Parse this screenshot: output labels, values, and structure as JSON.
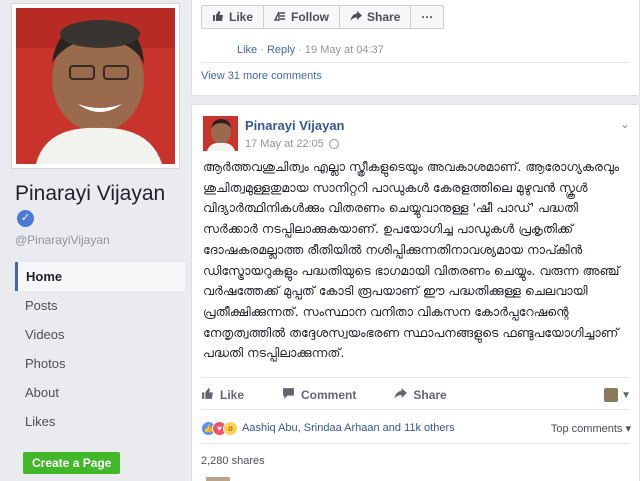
{
  "profile": {
    "name": "Pinarayi Vijayan",
    "verified_mark": "✓",
    "handle": "@PinarayiVijayan"
  },
  "nav": {
    "items": [
      "Home",
      "Posts",
      "Videos",
      "Photos",
      "About",
      "Likes"
    ],
    "active": "Home"
  },
  "create_page_label": "Create a Page",
  "previous_post": {
    "actions": {
      "like": "Like",
      "follow": "Follow",
      "share": "Share",
      "more": "···"
    },
    "comment_meta": {
      "like": "Like",
      "reply": "Reply",
      "time": "19 May at 04:37"
    },
    "view_more": "View 31 more comments"
  },
  "post": {
    "author": "Pinarayi Vijayan",
    "time": "17 May at 22:05",
    "text": "ആർത്തവശുചിത്വം എല്ലാ സ്ത്രീകളുടെയും അവകാശമാണ്. ആരോഗ്യകരവും ശുചിത്വമുള്ളതുമായ സാനിറ്ററി പാഡുകൾ കേരളത്തിലെ മുഴുവൻ സ്കൂൾ വിദ്യാർത്ഥിനികൾക്കും വിതരണം ചെയ്യുവാനുള്ള 'ഷീ പാഡ്' പദ്ധതി സർക്കാർ നടപ്പിലാക്കുകയാണ്. ഉപയോഗിച്ച പാഡുകൾ പ്രകൃതിക്ക് ദോഷകരമല്ലാത്ത രീതിയിൽ നശിപ്പിക്കുന്നതിനാവശ്യമായ നാപ്കിൻ ഡിസ്ട്രോയറുകളും പദ്ധതിയുടെ ഭാഗമായി വിതരണം ചെയ്യും. വരുന്ന അഞ്ച് വർഷത്തേക്ക് മുപ്പത് കോടി രൂപയാണ് ഈ പദ്ധതിക്കുള്ള ചെലവായി പ്രതീക്ഷിക്കുന്നത്. സംസ്ഥാന വനിതാ വികസന കോർപ്പറേഷന്റെ നേതൃത്വത്തിൽ തദ്ദേശസ്വയംഭരണ സ്ഥാപനങ്ങളുടെ ഫണ്ടുപയോഗിച്ചാണ് പദ്ധതി നടപ്പിലാക്കുന്നത്.",
    "actions": {
      "like": "Like",
      "comment": "Comment",
      "share": "Share"
    },
    "reactions_text": "Aashiq Abu, Srindaa Arhaan and 11k others",
    "top_comments": "Top comments",
    "shares": "2,280 shares"
  },
  "colors": {
    "fb_blue": "#4267b2",
    "link": "#365899",
    "create_green": "#42b72a",
    "verified": "#4b79d8"
  }
}
